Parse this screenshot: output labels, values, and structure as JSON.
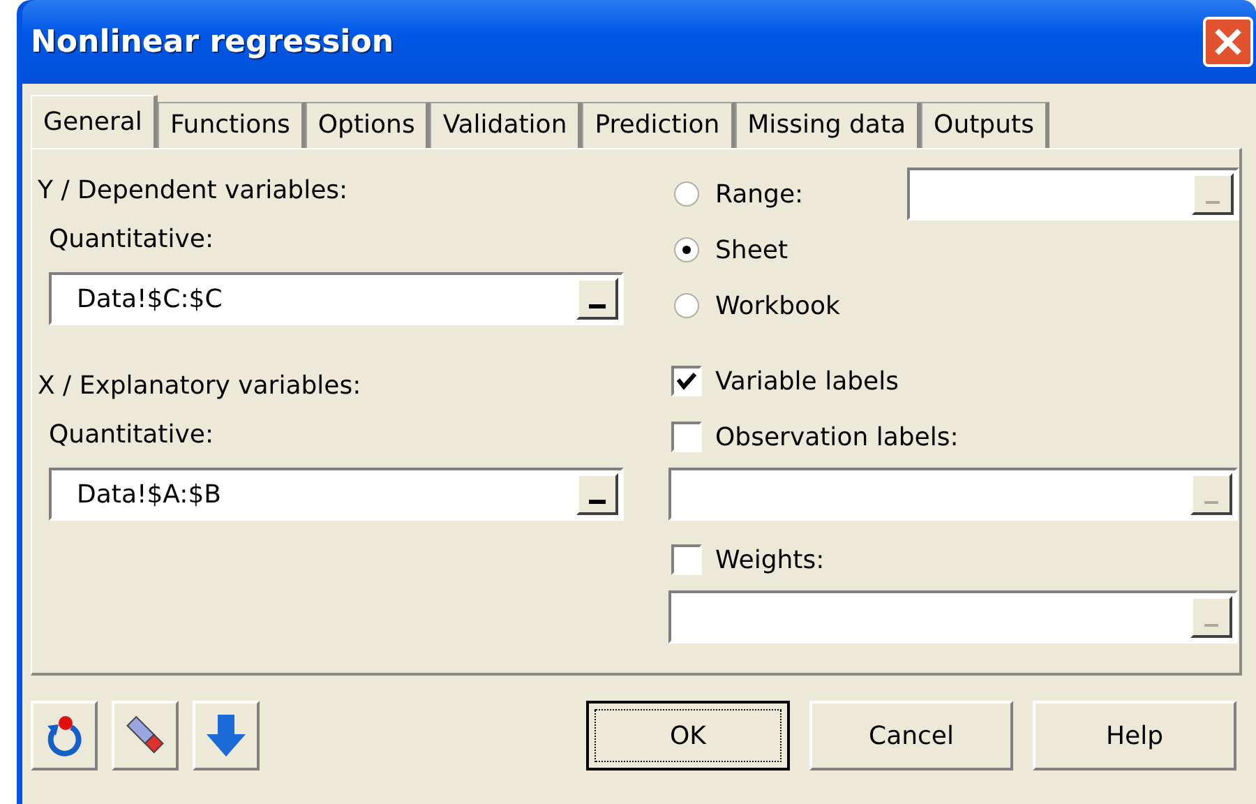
{
  "window": {
    "title": "Nonlinear regression"
  },
  "tabs": [
    {
      "label": "General",
      "selected": true
    },
    {
      "label": "Functions",
      "selected": false
    },
    {
      "label": "Options",
      "selected": false
    },
    {
      "label": "Validation",
      "selected": false
    },
    {
      "label": "Prediction",
      "selected": false
    },
    {
      "label": "Missing data",
      "selected": false
    },
    {
      "label": "Outputs",
      "selected": false
    }
  ],
  "variables": [
    {
      "heading": "Y / Dependent variables:",
      "label": "Quantitative:",
      "value": "Data!$C:$C"
    },
    {
      "heading": "X / Explanatory variables:",
      "label": "Quantitative:",
      "value": "Data!$A:$B"
    }
  ],
  "range_options": [
    {
      "label": "Range:",
      "selected": false,
      "kind": "field"
    },
    {
      "label": "Sheet",
      "selected": true,
      "kind": "plain"
    },
    {
      "label": "Workbook",
      "selected": false,
      "kind": "plain"
    }
  ],
  "checkboxes": [
    {
      "label": "Variable labels",
      "checked": true,
      "kind": "plain"
    },
    {
      "label": "Observation labels:",
      "checked": false,
      "kind": "field"
    },
    {
      "label": "Weights:",
      "checked": false,
      "kind": "field"
    }
  ],
  "buttons": [
    {
      "label": "OK",
      "focused": true
    },
    {
      "label": "Cancel",
      "focused": false
    },
    {
      "label": "Help",
      "focused": false
    }
  ]
}
